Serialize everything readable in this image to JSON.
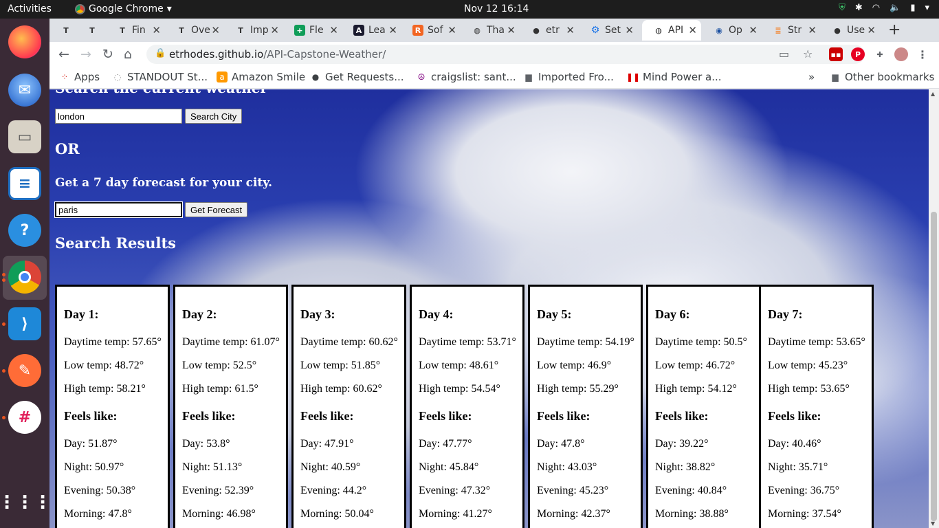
{
  "topbar": {
    "activities": "Activities",
    "app_name": "Google Chrome",
    "clock": "Nov 12  16:14"
  },
  "chrome": {
    "tabs": [
      {
        "label": "",
        "icon": "T"
      },
      {
        "label": "",
        "icon": "T"
      },
      {
        "label": "Fin",
        "icon": "T"
      },
      {
        "label": "Ove",
        "icon": "T"
      },
      {
        "label": "Imp",
        "icon": "T"
      },
      {
        "label": "Fle",
        "icon": "+"
      },
      {
        "label": "Lea",
        "icon": "A"
      },
      {
        "label": "Sof",
        "icon": "R"
      },
      {
        "label": "Tha",
        "icon": "globe"
      },
      {
        "label": "etr",
        "icon": "github"
      },
      {
        "label": "Set",
        "icon": "gear"
      },
      {
        "label": "API",
        "icon": "globe"
      },
      {
        "label": "Op",
        "icon": "person"
      },
      {
        "label": "Str",
        "icon": "stack"
      },
      {
        "label": "Use",
        "icon": "github"
      }
    ],
    "url_host": "etrhodes.github.io",
    "url_path": "/API-Capstone-Weather/",
    "bookmarks": [
      {
        "label": "Apps"
      },
      {
        "label": "STANDOUT St..."
      },
      {
        "label": "Amazon Smile"
      },
      {
        "label": "Get Requests..."
      },
      {
        "label": "craigslist: sant..."
      },
      {
        "label": "Imported Fro..."
      },
      {
        "label": "Mind Power a..."
      }
    ],
    "other_bookmarks": "Other bookmarks"
  },
  "page": {
    "cut_heading": "Search the current weather",
    "city_input_value": "london",
    "search_city_button": "Search City",
    "or_heading": "OR",
    "forecast_heading": "Get a 7 day forecast for your city.",
    "forecast_input_value": "paris",
    "get_forecast_button": "Get Forecast",
    "results_heading": "Search Results",
    "days": [
      {
        "title": "Day 1:",
        "daytime": "Daytime temp: 57.65°",
        "low": "Low temp: 48.72°",
        "high": "High temp: 58.21°",
        "feels": "Feels like:",
        "day": "Day: 51.87°",
        "night": "Night: 50.97°",
        "evening": "Evening: 50.38°",
        "morning": "Morning: 47.8°"
      },
      {
        "title": "Day 2:",
        "daytime": "Daytime temp: 61.07°",
        "low": "Low temp: 52.5°",
        "high": "High temp: 61.5°",
        "feels": "Feels like:",
        "day": "Day: 53.8°",
        "night": "Night: 51.13°",
        "evening": "Evening: 52.39°",
        "morning": "Morning: 46.98°"
      },
      {
        "title": "Day 3:",
        "daytime": "Daytime temp: 60.62°",
        "low": "Low temp: 51.85°",
        "high": "High temp: 60.62°",
        "feels": "Feels like:",
        "day": "Day: 47.91°",
        "night": "Night: 40.59°",
        "evening": "Evening: 44.2°",
        "morning": "Morning: 50.04°"
      },
      {
        "title": "Day 4:",
        "daytime": "Daytime temp: 53.71°",
        "low": "Low temp: 48.61°",
        "high": "High temp: 54.54°",
        "feels": "Feels like:",
        "day": "Day: 47.77°",
        "night": "Night: 45.84°",
        "evening": "Evening: 47.32°",
        "morning": "Morning: 41.27°"
      },
      {
        "title": "Day 5:",
        "daytime": "Daytime temp: 54.19°",
        "low": "Low temp: 46.9°",
        "high": "High temp: 55.29°",
        "feels": "Feels like:",
        "day": "Day: 47.8°",
        "night": "Night: 43.03°",
        "evening": "Evening: 45.23°",
        "morning": "Morning: 42.37°"
      },
      {
        "title": "Day 6:",
        "daytime": "Daytime temp: 50.5°",
        "low": "Low temp: 46.72°",
        "high": "High temp: 54.12°",
        "feels": "Feels like:",
        "day": "Day: 39.22°",
        "night": "Night: 38.82°",
        "evening": "Evening: 40.84°",
        "morning": "Morning: 38.88°"
      },
      {
        "title": "Day 7:",
        "daytime": "Daytime temp: 53.65°",
        "low": "Low temp: 45.23°",
        "high": "High temp: 53.65°",
        "feels": "Feels like:",
        "day": "Day: 40.46°",
        "night": "Night: 35.71°",
        "evening": "Evening: 36.75°",
        "morning": "Morning: 37.54°"
      }
    ]
  }
}
